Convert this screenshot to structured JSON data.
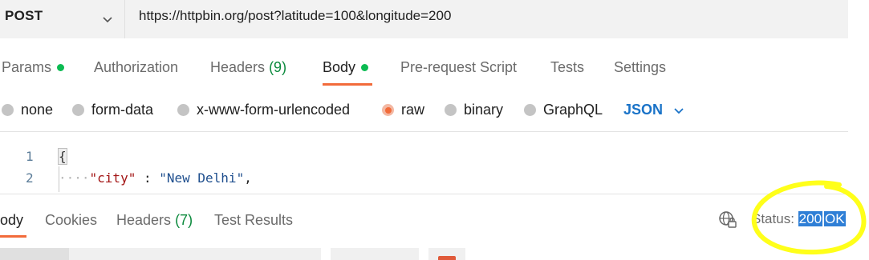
{
  "request": {
    "method": "POST",
    "url": "https://httpbin.org/post?latitude=100&longitude=200"
  },
  "request_tabs": [
    {
      "label": "Params",
      "dot": true
    },
    {
      "label": "Authorization"
    },
    {
      "label": "Headers",
      "count": "(9)"
    },
    {
      "label": "Body",
      "dot": true,
      "active": true
    },
    {
      "label": "Pre-request Script"
    },
    {
      "label": "Tests"
    },
    {
      "label": "Settings"
    }
  ],
  "body_types": [
    "none",
    "form-data",
    "x-www-form-urlencoded",
    "raw",
    "binary",
    "GraphQL"
  ],
  "selected_body_type": "raw",
  "format": "JSON",
  "editor": {
    "lines": [
      {
        "number": "1",
        "text": "{"
      },
      {
        "number": "2",
        "key": "\"city\"",
        "sep": " : ",
        "value": "\"New Delhi\"",
        "trail": ","
      }
    ]
  },
  "response_tabs": [
    {
      "label": "ody",
      "active": true
    },
    {
      "label": "Cookies"
    },
    {
      "label": "Headers",
      "count": "(7)"
    },
    {
      "label": "Test Results"
    }
  ],
  "status": {
    "label": "Status:",
    "code": "200",
    "text": "OK"
  },
  "colors": {
    "accent": "#f26b3a",
    "indicator_dot": "#0cbb52",
    "link_blue": "#1a73c8",
    "highlight": "#2f7fd6",
    "annotation_yellow": "#ffff1a"
  }
}
